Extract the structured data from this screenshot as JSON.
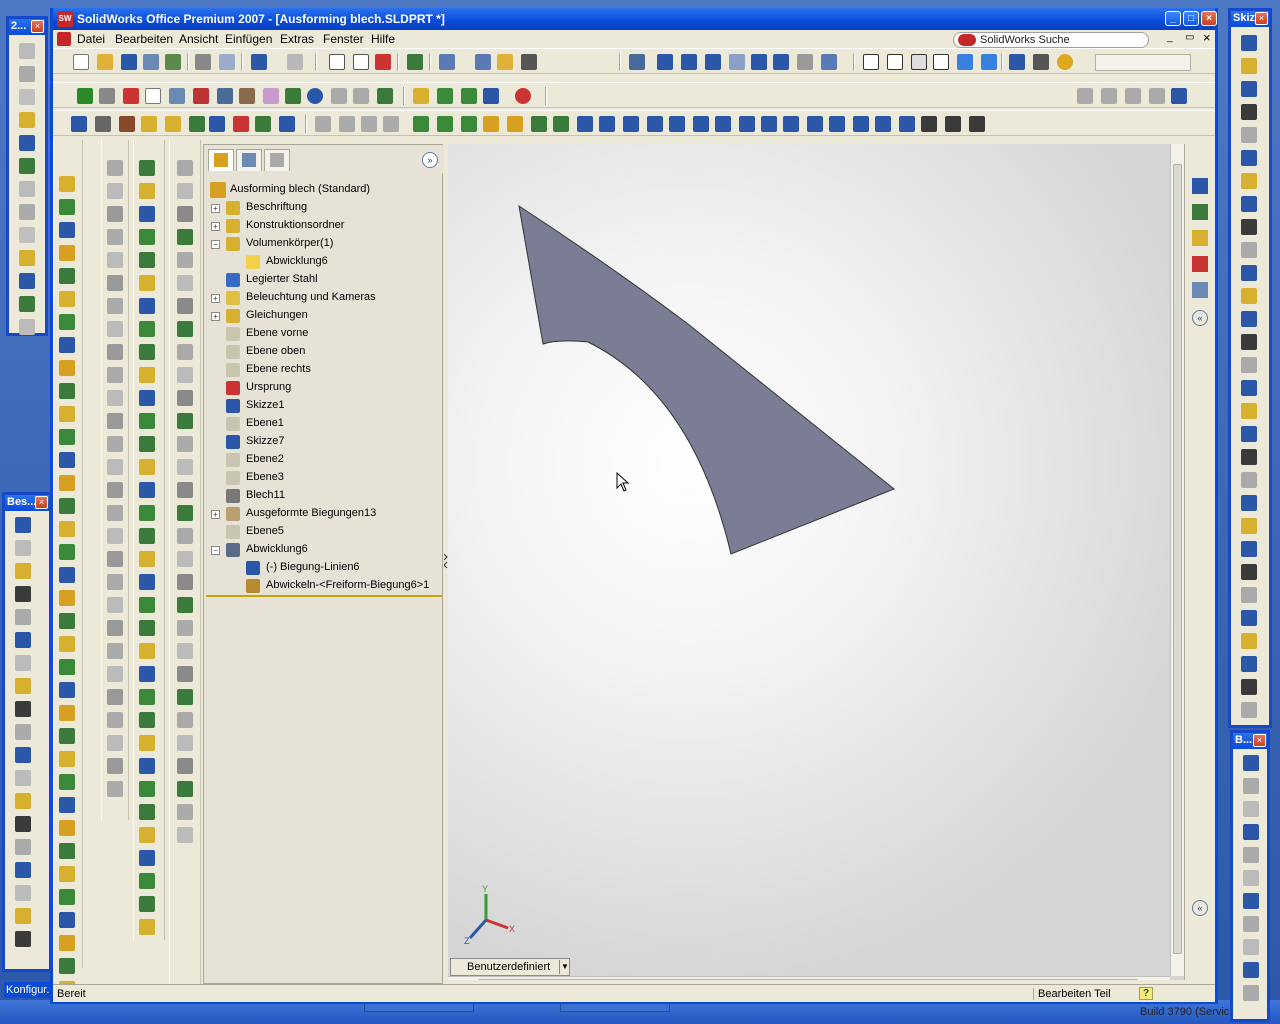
{
  "window": {
    "title": "SolidWorks Office Premium 2007 - [Ausforming blech.SLDPRT *]",
    "min_label": "_",
    "max_label": "□",
    "close_label": "×"
  },
  "menubar": {
    "items": [
      "Datei",
      "Bearbeiten",
      "Ansicht",
      "Einfügen",
      "Extras",
      "Fenster",
      "Hilfe"
    ],
    "search_placeholder": "SolidWorks Suche"
  },
  "feature_tree": {
    "expand_label": "»",
    "root": "Ausforming blech  (Standard)",
    "items": [
      {
        "label": "Beschriftung",
        "toggle": "+",
        "indent": 0,
        "icon": "annotations-icon"
      },
      {
        "label": "Konstruktionsordner",
        "toggle": "+",
        "indent": 0,
        "icon": "design-binder-icon"
      },
      {
        "label": "Volumenkörper(1)",
        "toggle": "−",
        "indent": 0,
        "icon": "solid-bodies-icon"
      },
      {
        "label": "Abwicklung6",
        "toggle": "",
        "indent": 1,
        "icon": "body-icon"
      },
      {
        "label": "Legierter Stahl",
        "toggle": "",
        "indent": 0,
        "icon": "material-icon"
      },
      {
        "label": "Beleuchtung und Kameras",
        "toggle": "+",
        "indent": 0,
        "icon": "lights-icon"
      },
      {
        "label": "Gleichungen",
        "toggle": "+",
        "indent": 0,
        "icon": "equations-icon"
      },
      {
        "label": "Ebene vorne",
        "toggle": "",
        "indent": 0,
        "icon": "plane-icon"
      },
      {
        "label": "Ebene oben",
        "toggle": "",
        "indent": 0,
        "icon": "plane-icon"
      },
      {
        "label": "Ebene rechts",
        "toggle": "",
        "indent": 0,
        "icon": "plane-icon"
      },
      {
        "label": "Ursprung",
        "toggle": "",
        "indent": 0,
        "icon": "origin-icon"
      },
      {
        "label": "Skizze1",
        "toggle": "",
        "indent": 0,
        "icon": "sketch-icon"
      },
      {
        "label": "Ebene1",
        "toggle": "",
        "indent": 0,
        "icon": "plane-icon"
      },
      {
        "label": "Skizze7",
        "toggle": "",
        "indent": 0,
        "icon": "sketch-icon"
      },
      {
        "label": "Ebene2",
        "toggle": "",
        "indent": 0,
        "icon": "plane-icon"
      },
      {
        "label": "Ebene3",
        "toggle": "",
        "indent": 0,
        "icon": "plane-icon"
      },
      {
        "label": "Blech11",
        "toggle": "",
        "indent": 0,
        "icon": "sheet-metal-icon"
      },
      {
        "label": "Ausgeformte Biegungen13",
        "toggle": "+",
        "indent": 0,
        "icon": "lofted-bend-icon"
      },
      {
        "label": "Ebene5",
        "toggle": "",
        "indent": 0,
        "icon": "plane-icon"
      },
      {
        "label": "Abwicklung6",
        "toggle": "−",
        "indent": 0,
        "icon": "flatten-icon"
      },
      {
        "label": "(-) Biegung-Linien6",
        "toggle": "",
        "indent": 1,
        "icon": "sketch-icon"
      },
      {
        "label": "Abwickeln-<Freiform-Biegung6>1",
        "toggle": "",
        "indent": 1,
        "icon": "flat-pattern-icon"
      }
    ]
  },
  "viewport": {
    "config_label": "Benutzerdefiniert",
    "part_color": "#7b7d95",
    "triad_labels": [
      "Y",
      "X",
      "Z"
    ]
  },
  "status": {
    "left": "Bereit",
    "right": "Bearbeiten Teil",
    "help": "?"
  },
  "floating": {
    "top_left_title": "2...",
    "besch_title": "Bes...",
    "skizze_title": "Skiz...",
    "b_title": "B...",
    "konfig": "Konfigur..."
  },
  "desktop": {
    "build": "Build 3790 (Servic"
  },
  "colors": {
    "accent": "#0a4bd6",
    "panel": "#ece9d8"
  }
}
